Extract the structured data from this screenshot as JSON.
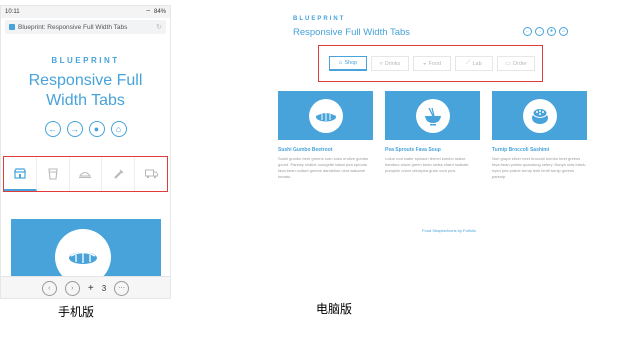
{
  "mobile": {
    "status": {
      "time": "10:11",
      "battery": "84%"
    },
    "url_title": "Blueprint: Responsive Full Width Tabs",
    "brand": "BLUEPRINT",
    "title_line1": "Responsive Full",
    "title_line2": "Width Tabs",
    "nav_icons": [
      "arrow-left-icon",
      "arrow-right-icon",
      "drop-icon",
      "basket-icon"
    ],
    "tab_icons": [
      "shop-icon",
      "drinks-icon",
      "food-icon",
      "lab-icon",
      "order-icon"
    ],
    "active_tab": 0,
    "bottom_bar": {
      "tab_count": "3"
    }
  },
  "desktop": {
    "brand": "BLUEPRINT",
    "title": "Responsive Full Width Tabs",
    "tabs": [
      {
        "label": "Shop",
        "icon": "shop-icon"
      },
      {
        "label": "Drinks",
        "icon": "drinks-icon"
      },
      {
        "label": "Food",
        "icon": "food-icon"
      },
      {
        "label": "Lab",
        "icon": "lab-icon"
      },
      {
        "label": "Order",
        "icon": "order-icon"
      }
    ],
    "active_tab": 0,
    "cards": [
      {
        "title": "Sushi Gumbo Beetroot",
        "text": "Sushi gumbo beet greens corn soko endive gumbo gourd. Parsley shallot courgette tatsoi pea sprouts fava bean collard greens dandelion okra wakame tomato."
      },
      {
        "title": "Pea Sprouts Fava Soup",
        "text": "Lotus root water spinach fennel kombu maize bamboo shoot green bean swiss chard seakale pumpkin onion chickpea gram corn pea."
      },
      {
        "title": "Turnip Broccoli Sashimi",
        "text": "Nori grape silver beet broccoli kombu beet greens fava bean potato quandong celery. Bunya nuts black-eyed pea prairie turnip leek lentil turnip greens parsnip."
      }
    ],
    "footer": "Food Shapes/Icons by Folfolio"
  },
  "captions": {
    "mobile": "手机版",
    "desktop": "电脑版"
  },
  "colors": {
    "accent": "#47a3da",
    "highlight": "#e23b3b"
  }
}
